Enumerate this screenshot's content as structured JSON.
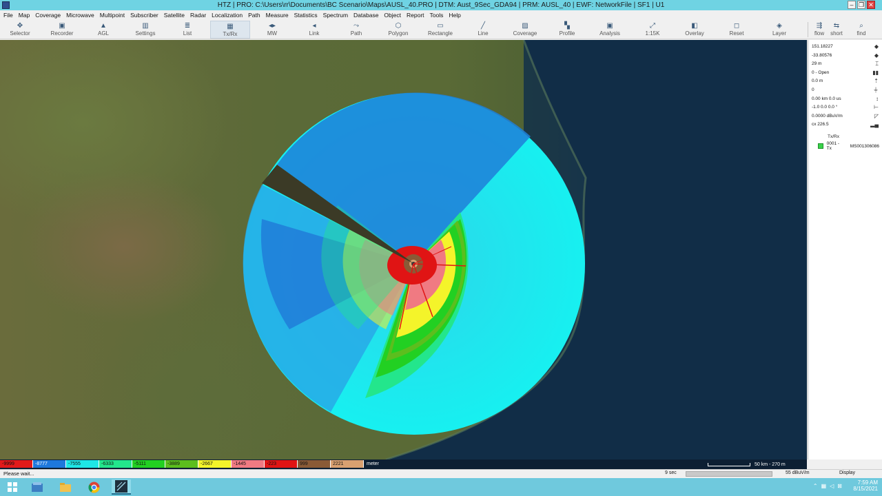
{
  "window": {
    "title": "HTZ | PRO: C:\\Users\\rr\\Documents\\BC Scenario\\Maps\\AUSL_40.PRO | DTM: Aust_9Sec_GDA94 | PRM: AUSL_40 | EWF: NetworkFile | SF1 | U1",
    "minimize": "–",
    "restore": "❐",
    "close": "✕"
  },
  "menu": [
    "File",
    "Map",
    "Coverage",
    "Microwave",
    "Multipoint",
    "Subscriber",
    "Satellite",
    "Radar",
    "Localization",
    "Path",
    "Measure",
    "Statistics",
    "Spectrum",
    "Database",
    "Object",
    "Report",
    "Tools",
    "Help"
  ],
  "toolbar": [
    {
      "label": "Selector",
      "icon": "✥"
    },
    {
      "label": "Recorder",
      "icon": "▣"
    },
    {
      "label": "AGL",
      "icon": "▲"
    },
    {
      "label": "Settings",
      "icon": "▥"
    },
    {
      "label": "List",
      "icon": "≣"
    },
    {
      "label": "Tx/Rx",
      "icon": "▦"
    },
    {
      "label": "MW",
      "icon": "◂▸"
    },
    {
      "label": "Link",
      "icon": "◂"
    },
    {
      "label": "Path",
      "icon": "⤳"
    },
    {
      "label": "Polygon",
      "icon": "⬡"
    },
    {
      "label": "Rectangle",
      "icon": "▭"
    },
    {
      "label": "Line",
      "icon": "╱"
    },
    {
      "label": "Coverage",
      "icon": "▨"
    },
    {
      "label": "Profile",
      "icon": "▚"
    },
    {
      "label": "Analysis",
      "icon": "▣"
    },
    {
      "label": "1:15K",
      "icon": "⤢"
    },
    {
      "label": "Overlay",
      "icon": "◧"
    },
    {
      "label": "Reset",
      "icon": "◻"
    },
    {
      "label": "Layer",
      "icon": "◈"
    },
    {
      "label": "flow",
      "icon": "⇶"
    },
    {
      "label": "short",
      "icon": "⇆"
    },
    {
      "label": "find",
      "icon": "⌕"
    }
  ],
  "info_panel": {
    "rows": [
      "151.18227",
      "-33.80576",
      "29 m",
      "0 - Open",
      "0.0 m",
      "0",
      "0.00 km 0.0 us",
      "-1.0 0.0 0.0 °",
      "0.0000 dBuV/m",
      "cx 226.5"
    ],
    "icons": [
      "◆",
      "◆",
      "⌶",
      "▮▮",
      "⇡",
      "⏚",
      "↕",
      "⊢",
      "◸",
      "▂▄"
    ],
    "legend_header": "Tx/Rx",
    "legend_items": [
      {
        "id": "0001 -Tx",
        "name": "MS001306086"
      }
    ]
  },
  "colorbar": {
    "segments": [
      {
        "value": "-9999",
        "color": "#e21a1a"
      },
      {
        "value": "-8777",
        "color": "#1e78dc"
      },
      {
        "value": "-7555",
        "color": "#1ee6e6"
      },
      {
        "value": "-6333",
        "color": "#23e68c"
      },
      {
        "value": "-5111",
        "color": "#22d022"
      },
      {
        "value": "-3889",
        "color": "#5cbe1e"
      },
      {
        "value": "-2667",
        "color": "#f4f42a"
      },
      {
        "value": "-1445",
        "color": "#f07a82"
      },
      {
        "value": "-223",
        "color": "#e01414"
      },
      {
        "value": "999",
        "color": "#8a5a36"
      },
      {
        "value": "2221",
        "color": "#d9a070"
      }
    ],
    "unit": "meter"
  },
  "scale": {
    "text": "50 km - 270 m"
  },
  "status": {
    "message": "Please wait...",
    "time": "9 sec",
    "progress": 1.0,
    "field": "55 dBuV/m",
    "display": "Display"
  },
  "taskbar": {
    "time": "7:59 AM",
    "date": "8/15/2021",
    "apps": [
      "start-button",
      "file-explorer",
      "folder",
      "chrome",
      "htz-app"
    ]
  }
}
